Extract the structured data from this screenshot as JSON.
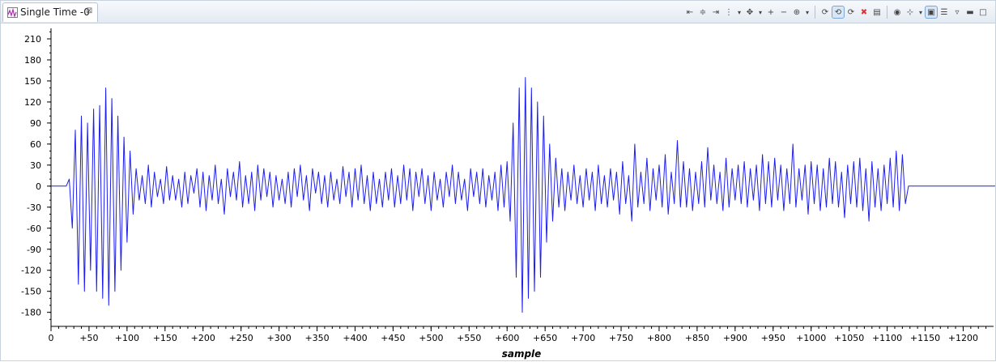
{
  "tab": {
    "title": "Single Time -0",
    "close_glyph": "⊠"
  },
  "toolbar": {
    "buttons": [
      {
        "name": "align-left-icon",
        "glyph": "⇤"
      },
      {
        "name": "align-center-icon",
        "glyph": "≑"
      },
      {
        "name": "align-right-icon",
        "glyph": "⇥"
      },
      {
        "name": "cursor-marker-icon",
        "glyph": "⋮"
      },
      {
        "name": "cursor-marker-dropdown-icon",
        "glyph": "▾",
        "drop": true
      },
      {
        "name": "pan-icon",
        "glyph": "✥"
      },
      {
        "name": "pan-dropdown-icon",
        "glyph": "▾",
        "drop": true
      },
      {
        "name": "zoom-in-icon",
        "glyph": "+"
      },
      {
        "name": "zoom-out-icon",
        "glyph": "−"
      },
      {
        "name": "zoom-fit-icon",
        "glyph": "⊕"
      },
      {
        "name": "zoom-fit-dropdown-icon",
        "glyph": "▾",
        "drop": true
      },
      {
        "sep": true
      },
      {
        "name": "refresh-icon",
        "glyph": "⟳"
      },
      {
        "name": "auto-refresh-icon",
        "glyph": "⟲",
        "pressed": true
      },
      {
        "name": "continuous-refresh-icon",
        "glyph": "⟳"
      },
      {
        "name": "stop-icon",
        "glyph": "✖",
        "color": "#d33"
      },
      {
        "name": "export-icon",
        "glyph": "▤"
      },
      {
        "sep": true
      },
      {
        "name": "binoculars-icon",
        "glyph": "◉"
      },
      {
        "name": "measure-icon",
        "glyph": "⊹"
      },
      {
        "name": "measure-dropdown-icon",
        "glyph": "▾",
        "drop": true
      },
      {
        "name": "display-properties-icon",
        "glyph": "▣",
        "pressed": true
      },
      {
        "name": "properties-icon",
        "glyph": "☰"
      },
      {
        "name": "view-menu-icon",
        "glyph": "▿"
      },
      {
        "name": "minimize-icon",
        "glyph": "▬"
      },
      {
        "name": "maximize-icon",
        "glyph": "□"
      }
    ]
  },
  "colors": {
    "series": "#1d1df0",
    "axis": "#000000",
    "label": "#000000"
  },
  "chart_data": {
    "type": "line",
    "xlabel": "sample",
    "ylabel": "",
    "xlim": [
      0,
      1240
    ],
    "ylim": [
      -200,
      225
    ],
    "x_ticks": [
      0,
      50,
      100,
      150,
      200,
      250,
      300,
      350,
      400,
      450,
      500,
      550,
      600,
      650,
      700,
      750,
      800,
      850,
      900,
      950,
      1000,
      1050,
      1100,
      1150,
      1200
    ],
    "x_tick_labels": [
      "0",
      "+50",
      "+100",
      "+150",
      "+200",
      "+250",
      "+300",
      "+350",
      "+400",
      "+450",
      "+500",
      "+550",
      "+600",
      "+650",
      "+700",
      "+750",
      "+800",
      "+850",
      "+900",
      "+950",
      "+1000",
      "+1050",
      "+1100",
      "+1150",
      "+1200"
    ],
    "y_ticks": [
      210,
      180,
      150,
      120,
      90,
      60,
      30,
      0,
      -30,
      -60,
      -90,
      -120,
      -150,
      -180
    ],
    "y_tick_labels": [
      "210",
      "180",
      "150",
      "120",
      "90",
      "60",
      "30",
      "0",
      "-30",
      "-60",
      "-90",
      "-120",
      "-150",
      "-180"
    ],
    "series": [
      {
        "x_start": 0,
        "x_step": 4,
        "values": [
          0,
          0,
          0,
          0,
          0,
          0,
          10,
          -60,
          80,
          -140,
          100,
          -150,
          90,
          -120,
          110,
          -150,
          115,
          -160,
          140,
          -170,
          125,
          -150,
          100,
          -120,
          70,
          -80,
          50,
          -40,
          25,
          -20,
          15,
          -25,
          30,
          -30,
          20,
          -15,
          10,
          -25,
          28,
          -20,
          15,
          -20,
          10,
          -30,
          20,
          -25,
          15,
          -10,
          25,
          -30,
          20,
          -35,
          15,
          -20,
          30,
          -25,
          10,
          -40,
          25,
          -15,
          20,
          -20,
          35,
          -30,
          15,
          -25,
          20,
          -35,
          30,
          -20,
          25,
          -15,
          20,
          -30,
          15,
          -20,
          10,
          -25,
          20,
          -30,
          25,
          -15,
          30,
          -20,
          15,
          -35,
          25,
          -10,
          20,
          -25,
          15,
          -30,
          20,
          -20,
          10,
          -25,
          28,
          -15,
          20,
          -30,
          25,
          -20,
          30,
          -25,
          15,
          -35,
          20,
          -25,
          10,
          -30,
          20,
          -20,
          25,
          -30,
          15,
          -25,
          30,
          -20,
          25,
          -35,
          20,
          -15,
          25,
          -25,
          15,
          -35,
          20,
          -20,
          10,
          -30,
          20,
          -15,
          30,
          -25,
          20,
          -20,
          10,
          -35,
          25,
          -15,
          20,
          -25,
          25,
          -30,
          15,
          -20,
          20,
          -35,
          30,
          -30,
          35,
          -50,
          90,
          -130,
          140,
          -180,
          155,
          -160,
          140,
          -150,
          120,
          -130,
          100,
          -80,
          60,
          -50,
          40,
          -30,
          25,
          -35,
          20,
          -20,
          30,
          -25,
          15,
          -30,
          25,
          -20,
          20,
          -35,
          30,
          -25,
          15,
          -30,
          25,
          -20,
          20,
          -40,
          35,
          -25,
          15,
          -50,
          60,
          -30,
          20,
          -25,
          40,
          -35,
          25,
          -20,
          30,
          -30,
          45,
          -40,
          20,
          -25,
          65,
          -30,
          35,
          -30,
          25,
          -35,
          20,
          -25,
          35,
          -30,
          55,
          -20,
          30,
          -25,
          20,
          -35,
          40,
          -30,
          25,
          -20,
          30,
          -25,
          35,
          -30,
          25,
          -20,
          30,
          -35,
          45,
          -25,
          35,
          -30,
          40,
          -20,
          30,
          -35,
          25,
          -25,
          60,
          -30,
          25,
          -20,
          30,
          -40,
          35,
          -25,
          30,
          -35,
          25,
          -30,
          40,
          -25,
          35,
          -30,
          20,
          -45,
          30,
          -25,
          35,
          -30,
          40,
          -35,
          25,
          -50,
          35,
          -30,
          25,
          -35,
          30,
          -25,
          40,
          -30,
          50,
          -35,
          45,
          -25,
          0,
          0,
          0,
          0,
          0,
          0,
          0,
          0,
          0,
          0,
          0,
          0,
          0,
          0,
          0,
          0,
          0,
          0,
          0,
          0,
          0,
          0,
          0,
          0,
          0,
          0,
          0,
          0,
          0,
          0,
          0,
          0,
          0,
          0,
          0,
          0,
          0,
          0,
          0,
          0,
          0,
          0,
          0,
          0,
          0,
          0,
          0,
          0,
          0,
          0,
          0
        ]
      }
    ],
    "grid": false,
    "legend": "none"
  }
}
